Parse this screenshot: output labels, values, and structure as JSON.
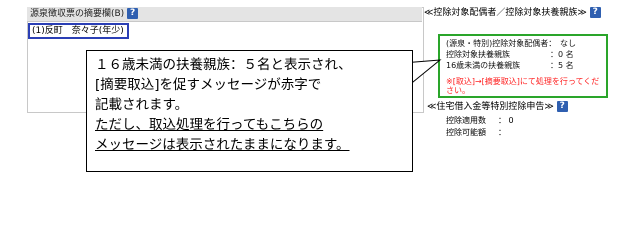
{
  "left": {
    "header_title": "源泉徴収票の摘要欄(B)",
    "help_glyph": "?",
    "summary_value": "(1)反町　奈々子(年少)"
  },
  "right": {
    "title": "≪控除対象配偶者／控除対象扶養親族≫",
    "help_glyph": "?",
    "rows": [
      {
        "label": "(源泉・特別)控除対象配偶者：",
        "value": "なし"
      },
      {
        "label": "控除対象扶養親族",
        "value": "：0 名"
      },
      {
        "label": "16歳未満の扶養親族",
        "value": "：5 名"
      }
    ],
    "warning": "※[取込]→[摘要取込]にて処理を行ってください。"
  },
  "loan": {
    "title": "≪住宅借入金等特別控除申告≫",
    "help_glyph": "?",
    "rows": [
      {
        "label": "控除適用数",
        "value": "： 0"
      },
      {
        "label": "控除可能額",
        "value": "："
      }
    ]
  },
  "callout": {
    "line1": "１６歳未満の扶養親族：５名と表示され、",
    "line2": "[摘要取込]を促すメッセージが赤字で",
    "line3": "記載されます。",
    "line4": "ただし、取込処理を行ってもこちらの",
    "line5": "メッセージは表示されたままになります。"
  },
  "colors": {
    "highlight_blue": "#2b3fb5",
    "highlight_green": "#2aa52a",
    "warning_red": "#ff2020",
    "help_icon_blue": "#2f5fb0"
  }
}
